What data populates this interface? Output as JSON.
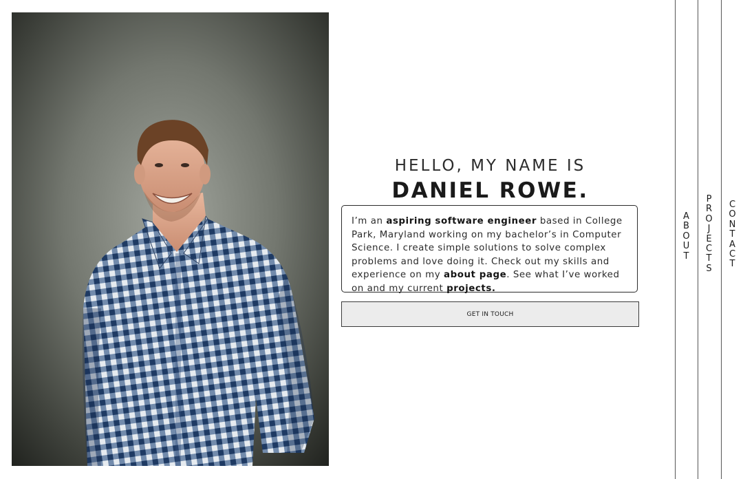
{
  "profile": {
    "photo_alt": "Portrait photo"
  },
  "intro": {
    "greeting": "HELLO, MY NAME IS",
    "name": "DANIEL ROWE."
  },
  "bio": {
    "p1": "I’m an ",
    "b1": "aspiring software engineer",
    "p2": " based in College Park, Maryland working on my bachelor’s in Computer Science. I create simple solutions to solve complex problems and love doing it. Check out my skills and experience on my ",
    "b2": "about page",
    "p3": ". See what I’ve worked on and my current ",
    "b3": "projects.",
    "p4": ""
  },
  "cta": {
    "label": "GET IN TOUCH"
  },
  "nav": {
    "items": [
      "ABOUT",
      "PROJECTS",
      "CONTACT"
    ]
  },
  "colors": {
    "background": "#ffffff",
    "text": "#1b1b1b",
    "button_bg": "#ececec",
    "border": "#2a2a2a"
  }
}
